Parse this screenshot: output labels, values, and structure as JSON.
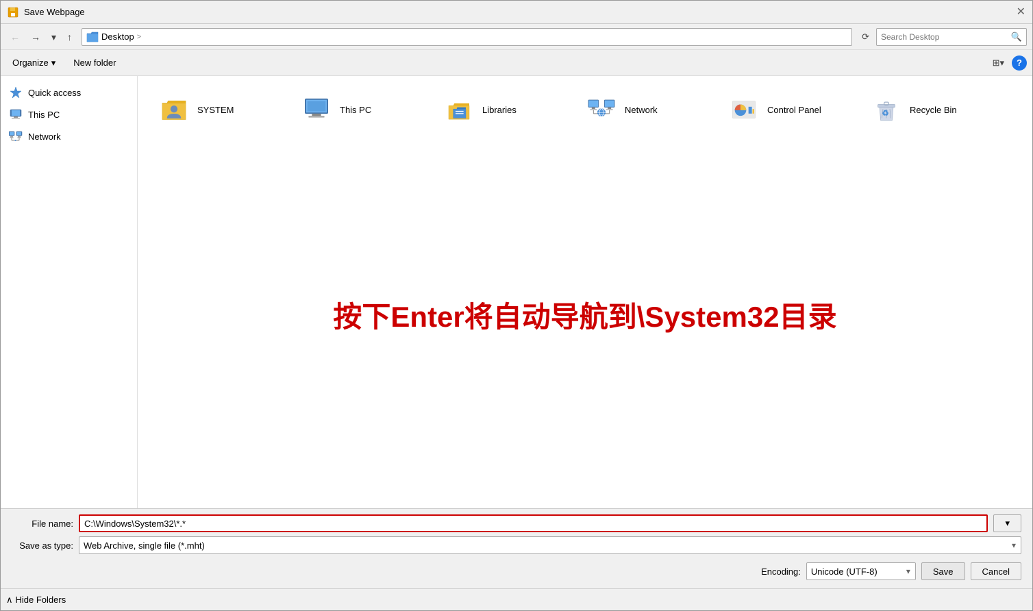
{
  "dialog": {
    "title": "Save Webpage",
    "close_label": "✕"
  },
  "nav": {
    "back_label": "←",
    "forward_label": "→",
    "dropdown_label": "▾",
    "up_label": "↑",
    "breadcrumb_icon": "🖥",
    "breadcrumb_text": "Desktop",
    "breadcrumb_sep": ">",
    "refresh_label": "⟳",
    "search_placeholder": "Search Desktop",
    "search_icon": "🔍"
  },
  "toolbar": {
    "organize_label": "Organize",
    "organize_arrow": "▾",
    "new_folder_label": "New folder",
    "view_icon": "⊞",
    "view_arrow": "▾",
    "help_label": "?"
  },
  "sidebar": {
    "items": [
      {
        "id": "quick-access",
        "label": "Quick access",
        "icon": "⭐"
      },
      {
        "id": "this-pc",
        "label": "This PC",
        "icon": "🖥"
      },
      {
        "id": "network",
        "label": "Network",
        "icon": "🌐"
      }
    ]
  },
  "content": {
    "items": [
      {
        "id": "system",
        "label": "SYSTEM",
        "icon": "folder-person"
      },
      {
        "id": "this-pc",
        "label": "This PC",
        "icon": "monitor"
      },
      {
        "id": "libraries",
        "label": "Libraries",
        "icon": "libraries"
      },
      {
        "id": "network",
        "label": "Network",
        "icon": "network"
      },
      {
        "id": "control-panel",
        "label": "Control Panel",
        "icon": "control"
      },
      {
        "id": "recycle-bin",
        "label": "Recycle Bin",
        "icon": "recycle"
      }
    ]
  },
  "annotation": {
    "text": "按下Enter将自动导航到\\System32目录"
  },
  "bottom": {
    "file_name_label": "File name:",
    "file_name_value": "C:\\Windows\\System32\\*.*",
    "save_type_label": "Save as type:",
    "save_type_value": "Web Archive, single file (*.mht)",
    "encoding_label": "Encoding:",
    "encoding_value": "Unicode (UTF-8)",
    "save_label": "Save",
    "cancel_label": "Cancel"
  },
  "footer": {
    "hide_folders_label": "Hide Folders",
    "hide_arrow": "∧"
  }
}
